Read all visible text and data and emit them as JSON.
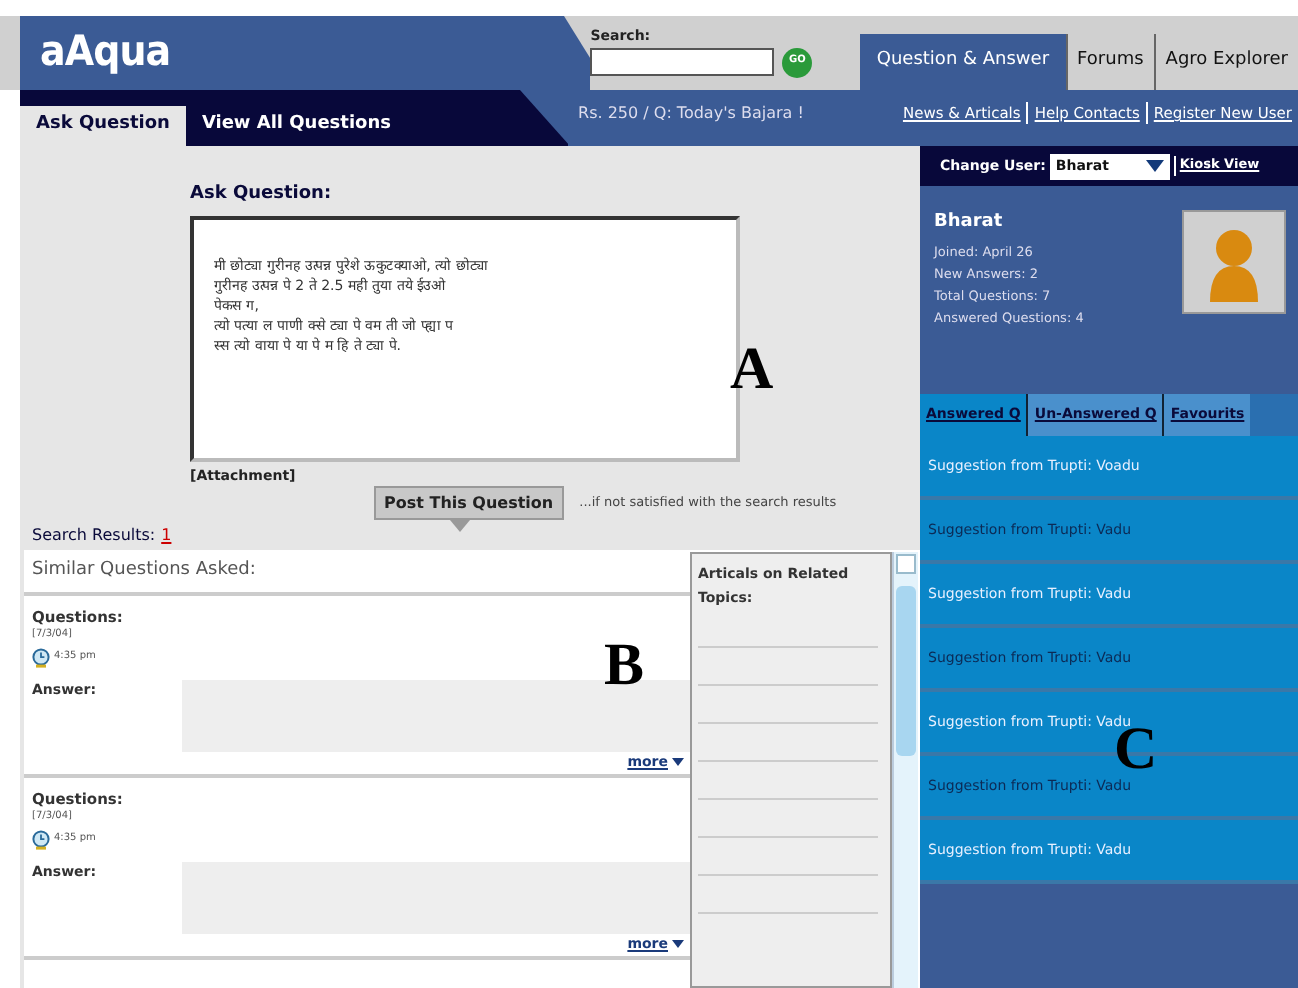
{
  "header": {
    "logo": "aAqua",
    "search": {
      "label": "Search:",
      "button": "GO"
    },
    "tabs": [
      {
        "label": "Question & Answer",
        "selected": true
      },
      {
        "label": "Forums",
        "selected": false
      },
      {
        "label": "Agro Explorer",
        "selected": false
      }
    ]
  },
  "subnav": {
    "tabs": [
      {
        "label": "Ask Question",
        "selected": true
      },
      {
        "label": "View All Questions",
        "selected": false
      }
    ],
    "ticker": "Rs. 250 / Q: Today's Bajara !",
    "links": [
      "News & Articals",
      "Help Contacts",
      "Register New User"
    ]
  },
  "user_bar": {
    "label": "Change User:",
    "value": "Bharat",
    "link": "Kiosk View"
  },
  "ask": {
    "title": "Ask Question:",
    "question": "मी छोट्या गुरीनह उत्पन्न पुरेशे ऊकुटक्याओ, त्यो छोट्या\nगुरीनह उत्पन्न पे 2 ते 2.5 मही तुया तये ईउओ\nपेकस ग,\nत्यो पत्या ल पाणी क्से ट्या पे वम ती जो प्ह्या प\nस्स त्यो वाया पे या पे म हि ते ट्या पे.",
    "attachment": "[Attachment]",
    "button": "Post This Question",
    "note": "...if not satisfied with the search results",
    "results_label": "Search Results:",
    "results_count": "1"
  },
  "similar": {
    "title": "Similar Questions Asked:",
    "items": [
      {
        "label": "Questions:",
        "date": "[7/3/04]",
        "time": "4:35 pm",
        "answer_label": "Answer:",
        "more": "more"
      },
      {
        "label": "Questions:",
        "date": "[7/3/04]",
        "time": "4:35 pm",
        "answer_label": "Answer:",
        "more": "more"
      }
    ]
  },
  "articles": {
    "title": "Articals on Related Topics:"
  },
  "profile": {
    "name": "Bharat",
    "stats": [
      "Joined: April 26",
      "New Answers: 2",
      "Total Questions: 7",
      "Answered Questions: 4"
    ]
  },
  "suggestion_tabs": [
    {
      "label": "Answered Q",
      "selected": true
    },
    {
      "label": "Un-Answered Q",
      "selected": false
    },
    {
      "label": "Favourits",
      "selected": false
    }
  ],
  "suggestions": [
    "Suggestion from Trupti: Voadu",
    "Suggestion from Trupti: Vadu",
    "Suggestion from Trupti: Vadu",
    "Suggestion from Trupti: Vadu",
    "Suggestion from Trupti: Vadu",
    "Suggestion from Trupti: Vadu",
    "Suggestion from Trupti: Vadu"
  ],
  "figure_labels": [
    "A",
    "B",
    "C"
  ]
}
